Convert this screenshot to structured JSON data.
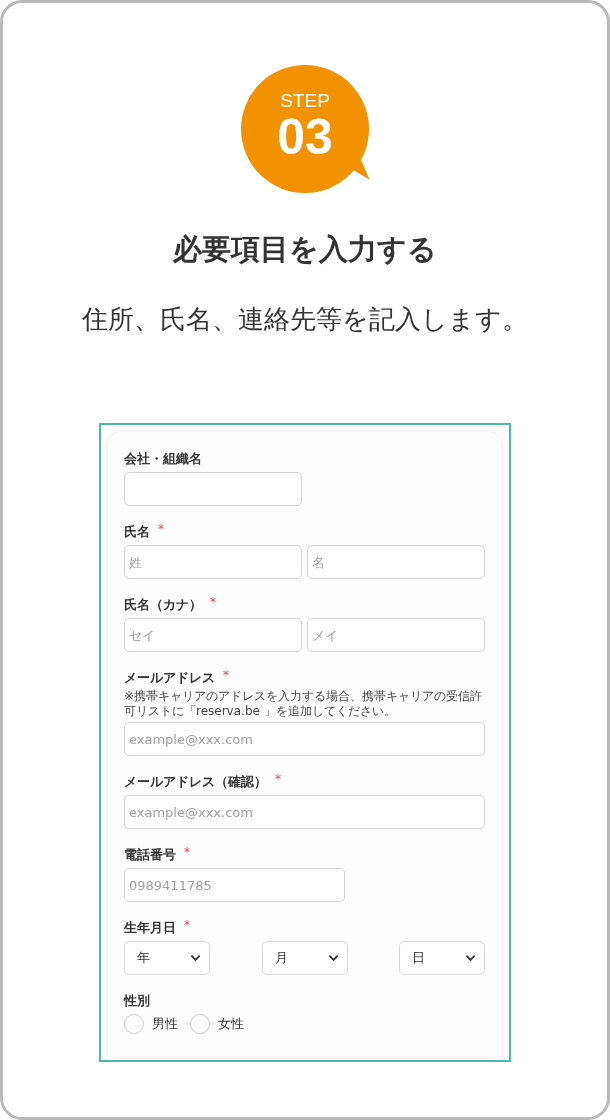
{
  "step": {
    "label": "STEP",
    "number": "03"
  },
  "title": "必要項目を入力する",
  "subtitle": "住所、氏名、連絡先等を記入します。",
  "form": {
    "sections": [
      {
        "kind": "single",
        "label": "会社・組織名"
      },
      {
        "kind": "pair",
        "label": "氏名",
        "required_mark": "*",
        "fields": [
          {
            "placeholder": "姓"
          },
          {
            "placeholder": "名"
          }
        ]
      },
      {
        "kind": "pair",
        "label": "氏名（カナ）",
        "required_mark": "*",
        "fields": [
          {
            "placeholder": "セイ"
          },
          {
            "placeholder": "メイ"
          }
        ]
      },
      {
        "kind": "wide",
        "label": "メールアドレス",
        "required_mark": "*",
        "note": "※携帯キャリアのアドレスを入力する場合、携帯キャリアの受信許可リストに「reserva.be 」を追加してください。",
        "fields": [
          {
            "placeholder": "example@xxx.com"
          }
        ]
      },
      {
        "kind": "wide",
        "label": "メールアドレス（確認）",
        "required_mark": "*",
        "fields": [
          {
            "placeholder": "example@xxx.com"
          }
        ]
      },
      {
        "kind": "medium",
        "label": "電話番号",
        "required_mark": "*",
        "fields": [
          {
            "placeholder": "0989411785"
          }
        ]
      },
      {
        "kind": "selects",
        "label": "生年月日",
        "required_mark": "*",
        "options": [
          "年",
          "月",
          "日"
        ]
      },
      {
        "kind": "radios",
        "label": "性別",
        "choices": [
          {
            "label": "男性",
            "selected": false
          },
          {
            "label": "女性",
            "selected": false
          }
        ]
      }
    ]
  }
}
